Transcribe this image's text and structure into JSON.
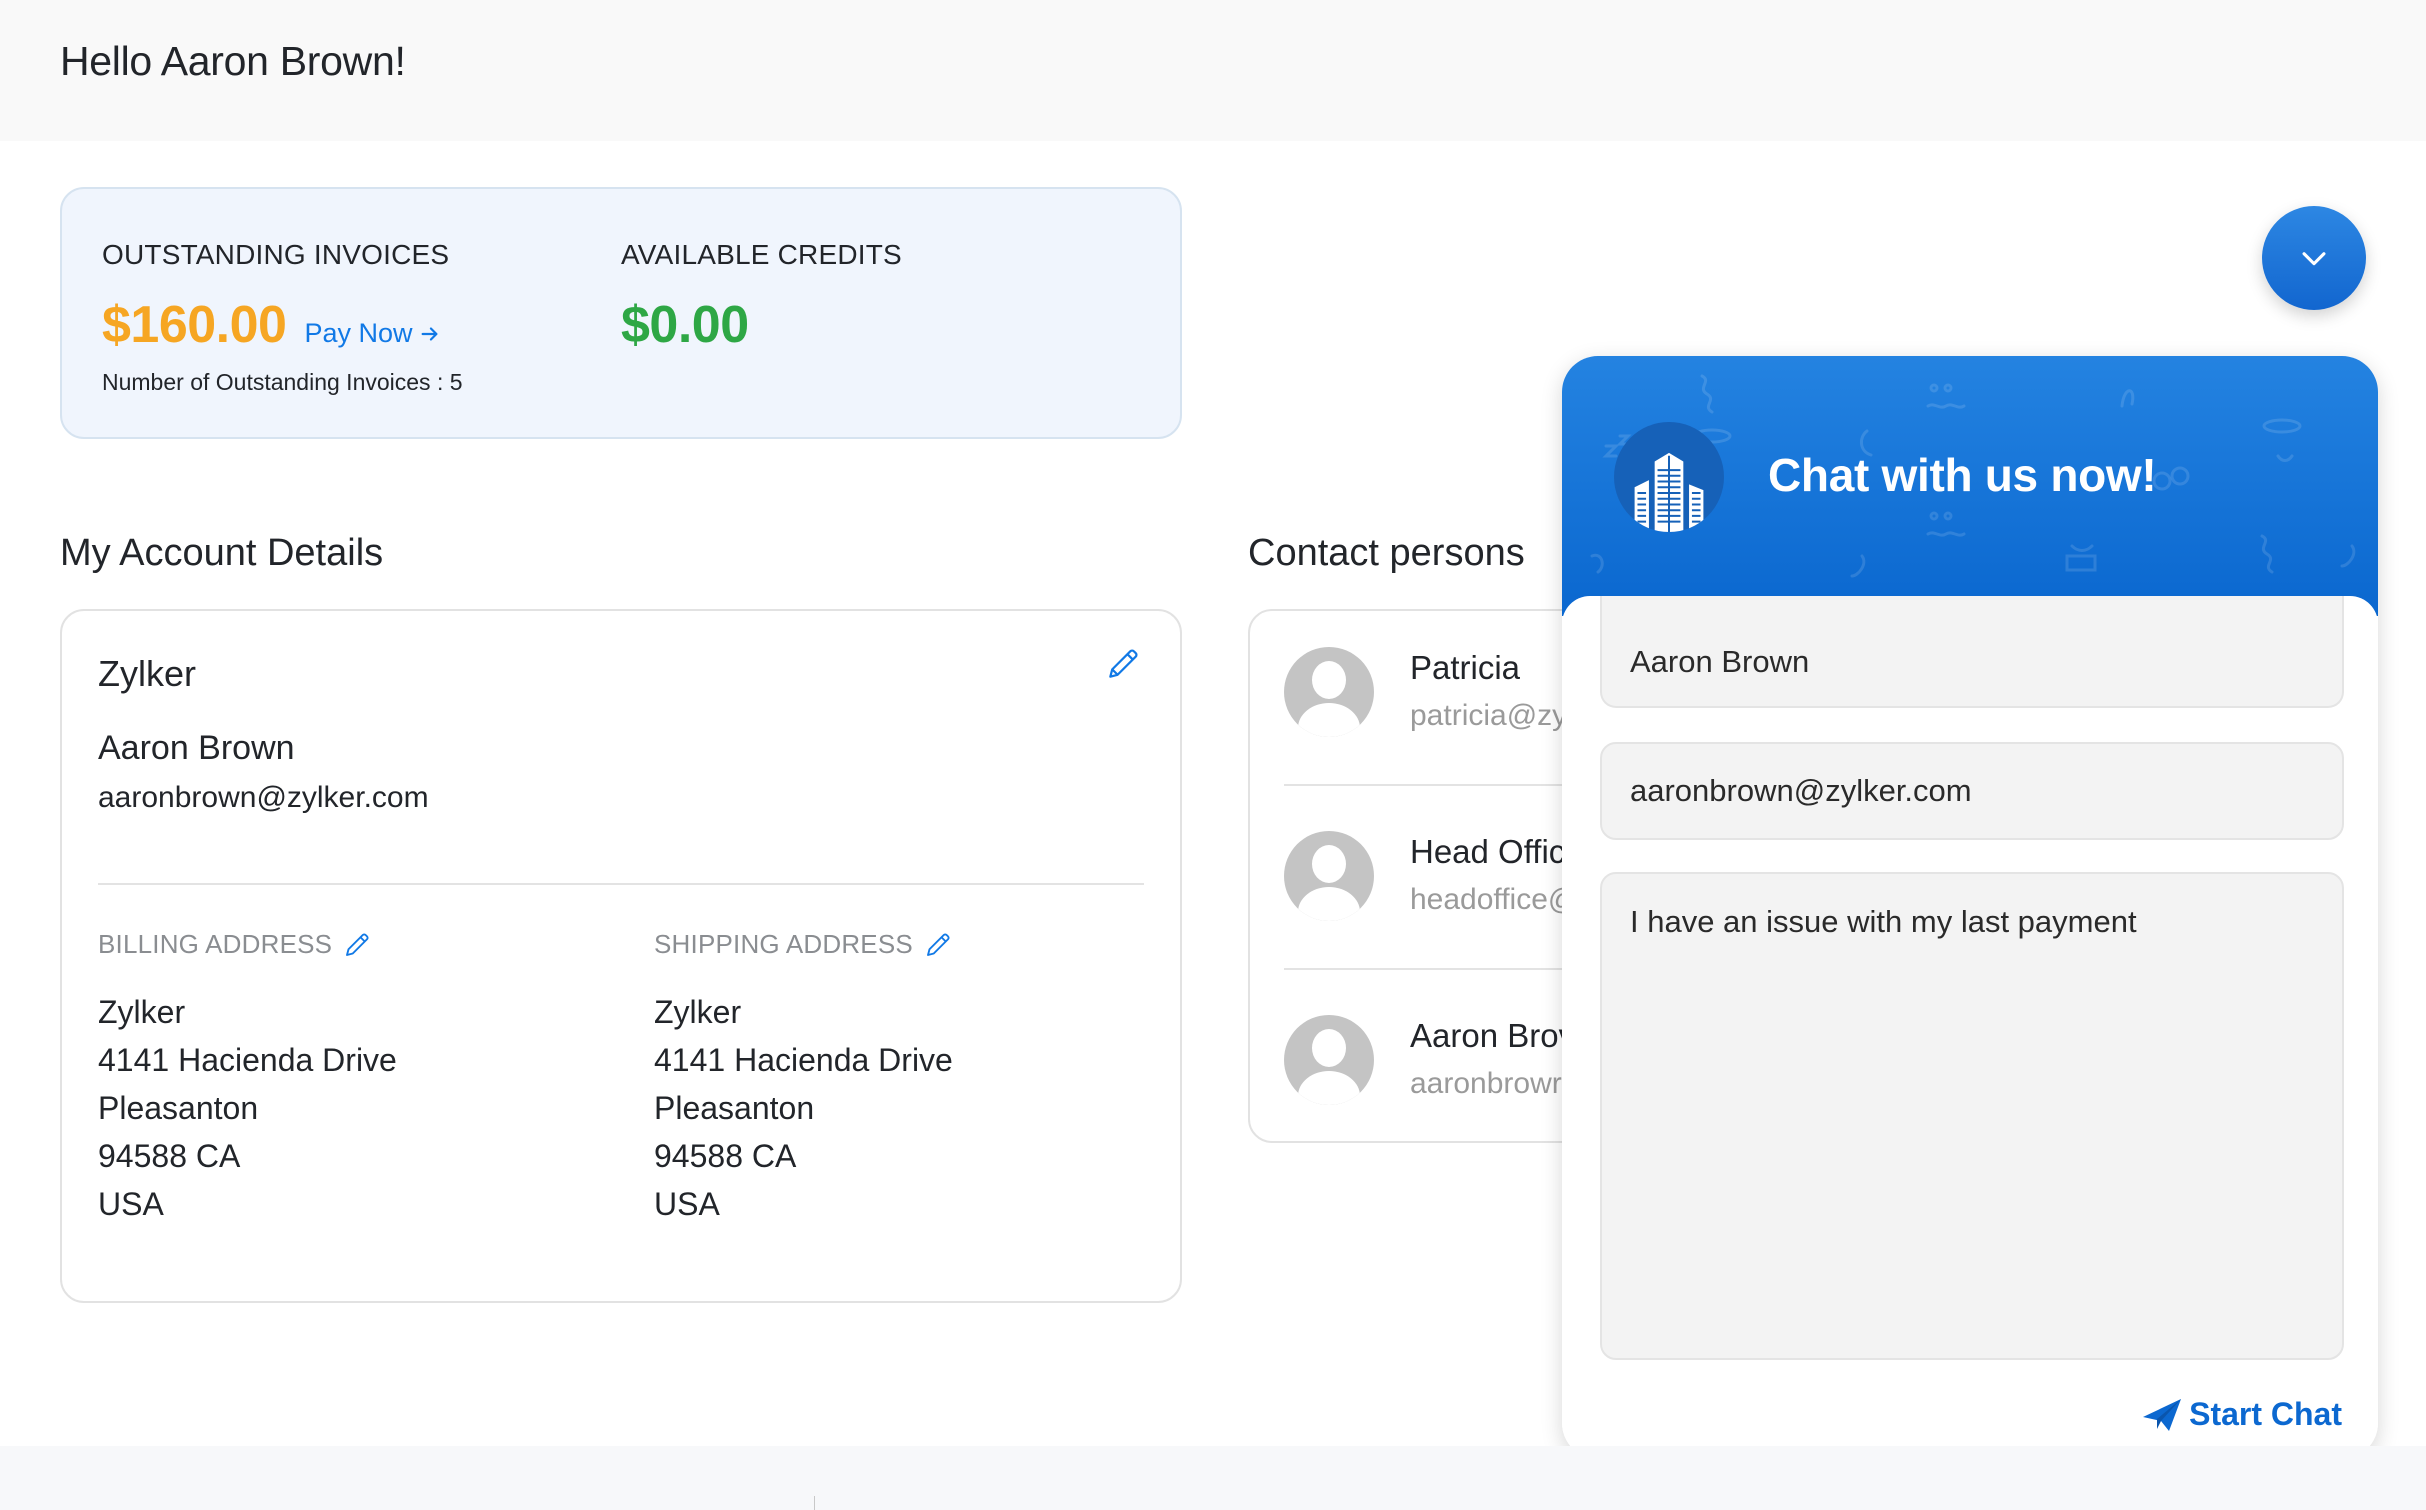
{
  "header": {
    "greeting": "Hello Aaron Brown!"
  },
  "summary": {
    "outstanding": {
      "label": "OUTSTANDING INVOICES",
      "amount": "$160.00",
      "pay_now_label": "Pay Now",
      "count_text": "Number of Outstanding Invoices : 5",
      "color": "#f6a623"
    },
    "credits": {
      "label": "AVAILABLE CREDITS",
      "amount": "$0.00",
      "color": "#2ea745"
    }
  },
  "account": {
    "section_title": "My Account Details",
    "company": "Zylker",
    "name": "Aaron Brown",
    "email": "aaronbrown@zylker.com",
    "billing": {
      "label": "BILLING ADDRESS",
      "lines": [
        "Zylker",
        "4141 Hacienda Drive",
        "Pleasanton",
        "94588 CA",
        "USA"
      ]
    },
    "shipping": {
      "label": "SHIPPING ADDRESS",
      "lines": [
        "Zylker",
        "4141 Hacienda Drive",
        "Pleasanton",
        "94588 CA",
        "USA"
      ]
    }
  },
  "contacts": {
    "section_title": "Contact persons",
    "items": [
      {
        "name": "Patricia",
        "email": "patricia@zy"
      },
      {
        "name": "Head Offic",
        "email": "headoffice@"
      },
      {
        "name": "Aaron Brov",
        "email": "aaronbrowr"
      }
    ]
  },
  "chat": {
    "toggle_icon": "chevron-down-icon",
    "title": "Chat with us now!",
    "logo_icon": "building-icon",
    "name_value": "Aaron Brown",
    "email_value": "aaronbrown@zylker.com",
    "message_value": "I have an issue with my last payment",
    "start_label": "Start Chat",
    "accent": "#0c68d0"
  }
}
